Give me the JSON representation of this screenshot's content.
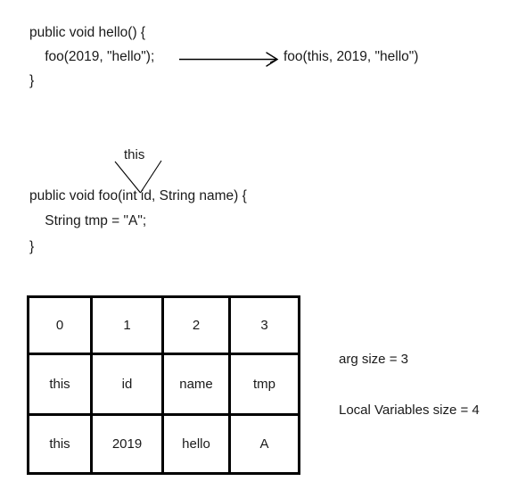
{
  "diagram": {
    "title": "Java method call frame diagram",
    "caller": {
      "lines": [
        "public void hello() {",
        "    foo(2019, \"hello\");",
        "}"
      ]
    },
    "transform_arrow": {
      "icon": "right-arrow-icon",
      "result_text": "foo(this, 2019, \"hello\")"
    },
    "callee": {
      "annotation": "this",
      "lines": [
        "public void foo(int id, String name) {",
        "    String tmp = \"A\";",
        "}"
      ]
    },
    "frame_table": {
      "rows": [
        {
          "name": "slot-index",
          "cells": [
            "0",
            "1",
            "2",
            "3"
          ]
        },
        {
          "name": "slot-name",
          "cells": [
            "this",
            "id",
            "name",
            "tmp"
          ]
        },
        {
          "name": "slot-value",
          "cells": [
            "this",
            "2019",
            "hello",
            "A"
          ]
        }
      ]
    },
    "notes": [
      "arg size = 3",
      "Local Variables size = 4"
    ],
    "colors": {
      "background": "#ffffff",
      "text": "#1a1a1a",
      "border": "#000000"
    }
  }
}
